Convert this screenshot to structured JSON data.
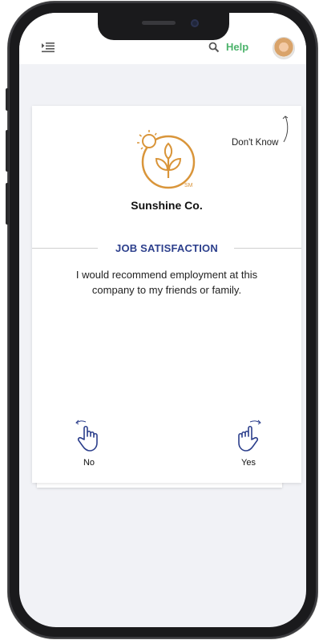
{
  "app": {
    "help_label": "Help"
  },
  "card": {
    "dont_know_label": "Don't Know",
    "company_name": "Sunshine Co.",
    "logo_mark": "SM",
    "section_title": "JOB SATISFACTION",
    "question": "I would recommend employment at this company to my friends or family.",
    "no_label": "No",
    "yes_label": "Yes"
  },
  "colors": {
    "accent_help": "#4cb36b",
    "section_title": "#2c3f8c",
    "logo_gold": "#d9953a",
    "icon_blue": "#2c3f8c"
  },
  "icons": {
    "menu": "menu-collapse-icon",
    "search": "search-icon",
    "no": "swipe-left-hand-icon",
    "yes": "swipe-right-hand-icon"
  }
}
